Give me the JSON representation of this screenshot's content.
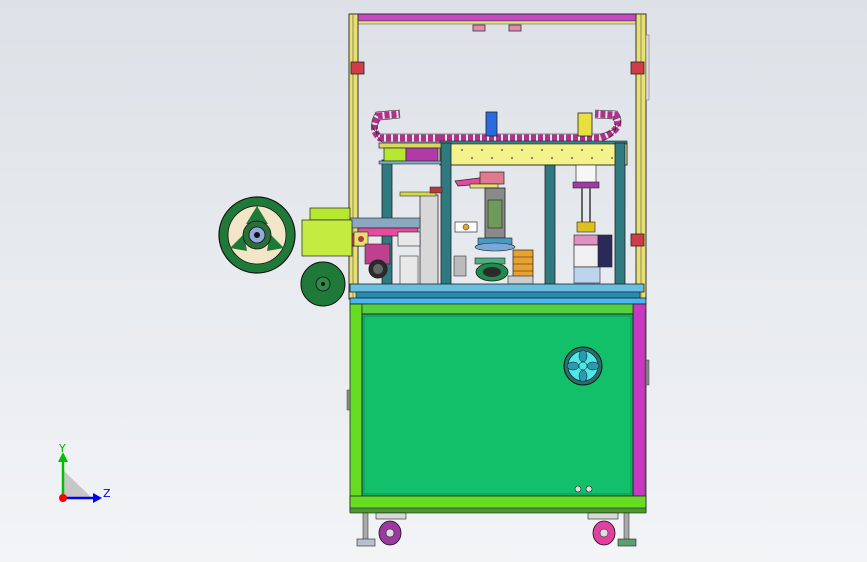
{
  "viewport": {
    "background_top": "#dde1e7",
    "background_bottom": "#f2f4f6"
  },
  "triad": {
    "y_label": "Y",
    "z_label": "Z",
    "y_color": "#00c000",
    "z_color": "#0000ff",
    "x_color": "#ff0000"
  },
  "colors": {
    "frame_yellow": "#e0d84a",
    "frame_purple": "#a23aa6",
    "cabinet_green": "#12c06a",
    "cabinet_lime": "#66dd22",
    "panel_dark": "#333333",
    "cable_chain": "#b0308a",
    "reel_green": "#1f7a3a",
    "reel_cream": "#f3e6c8",
    "fan_cyan": "#4ee8e8"
  }
}
